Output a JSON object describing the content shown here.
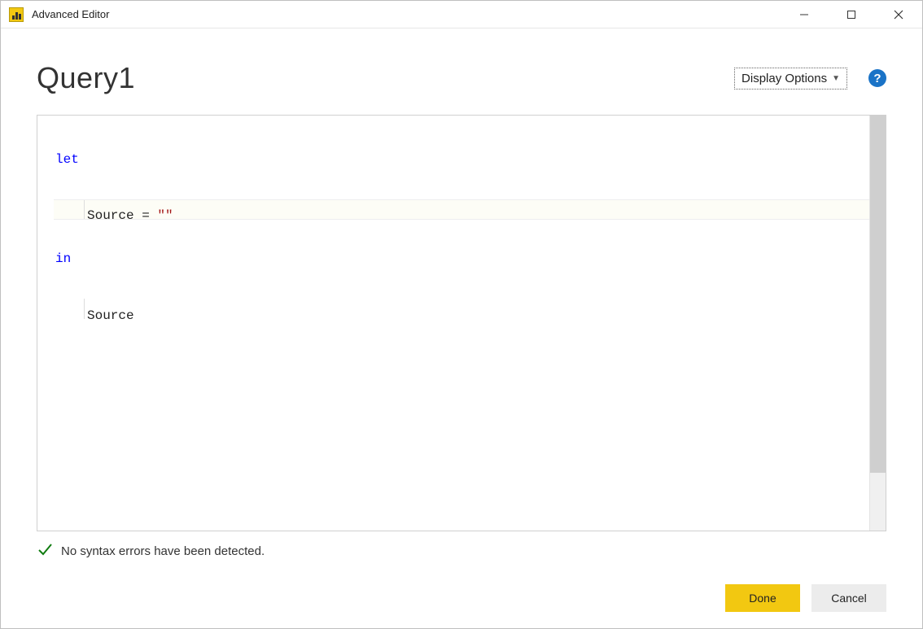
{
  "titlebar": {
    "title": "Advanced Editor"
  },
  "header": {
    "query_name": "Query1",
    "display_options_label": "Display Options",
    "help_glyph": "?"
  },
  "editor": {
    "keyword_let": "let",
    "assign_line_prefix": "Source = ",
    "string_literal": "\"\"",
    "keyword_in": "in",
    "result_line": "Source"
  },
  "status": {
    "message": "No syntax errors have been detected."
  },
  "footer": {
    "done_label": "Done",
    "cancel_label": "Cancel"
  }
}
